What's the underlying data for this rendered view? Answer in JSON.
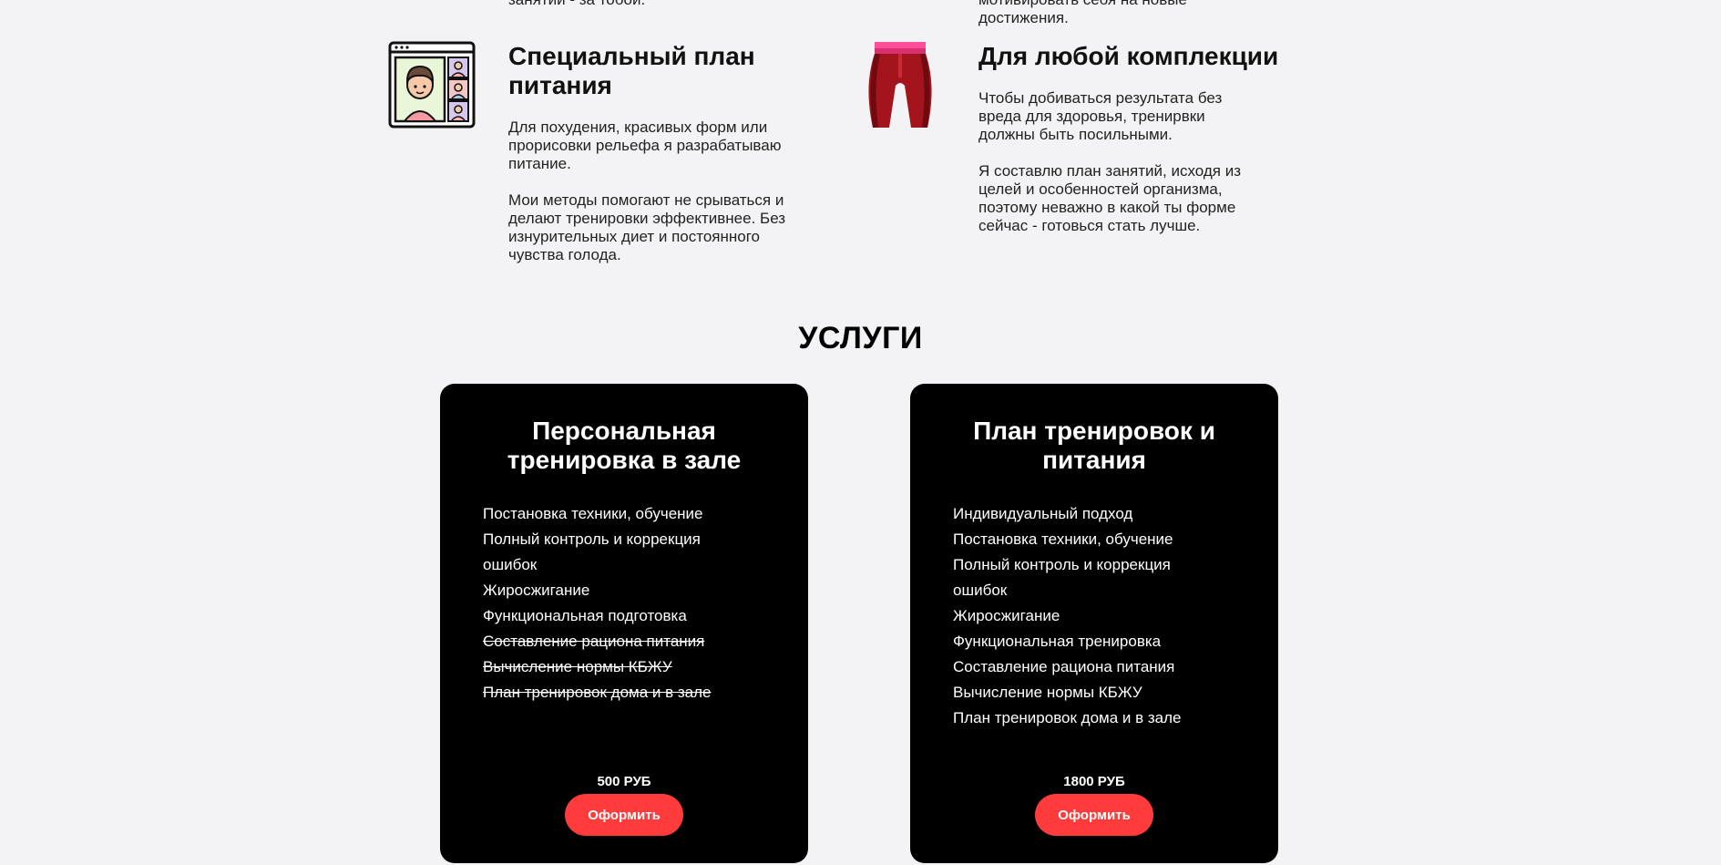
{
  "previous": {
    "left_tail": "занятий - за тобой.",
    "right_tail": [
      "мотивировать себя на новые",
      "достижения."
    ]
  },
  "features": [
    {
      "icon": "video-call-icon",
      "title": [
        "Специальный план",
        "питания"
      ],
      "paragraphs": [
        [
          "Для похудения, красивых форм или",
          "прорисовки рельефа я разрабатываю",
          "питание."
        ],
        [
          "Мои методы помогают не срываться и",
          "делают тренировки эффективнее. Без",
          "изнурительных диет и постоянного",
          "чувства голода."
        ]
      ]
    },
    {
      "icon": "leggings-icon",
      "title": [
        "Для любой комплекции"
      ],
      "paragraphs": [
        [
          "Чтобы добиваться результата без",
          "вреда для здоровья, тренирвки",
          "должны быть посильными."
        ],
        [
          "Я составлю план занятий, исходя из",
          "целей и особенностей организма,",
          "поэтому неважно в какой ты форме",
          "сейчас - готовься стать лучше."
        ]
      ]
    }
  ],
  "services": {
    "title": "УСЛУГИ",
    "cards": [
      {
        "title": [
          "Персональная",
          "тренировка в зале"
        ],
        "items": [
          {
            "text": "Постановка техники, обучение",
            "struck": false
          },
          {
            "text": "Полный контроль и коррекция",
            "struck": false
          },
          {
            "text": "ошибок",
            "struck": false
          },
          {
            "text": "Жиросжигание",
            "struck": false
          },
          {
            "text": "Функциональная подготовка",
            "struck": false
          },
          {
            "text": "Составление рациона питания",
            "struck": true
          },
          {
            "text": "Вычисление нормы КБЖУ",
            "struck": true
          },
          {
            "text": "План тренировок дома и в зале",
            "struck": true
          }
        ],
        "price": "500 РУБ",
        "button": "Оформить"
      },
      {
        "title": [
          "План тренировок и",
          "питания"
        ],
        "items": [
          {
            "text": "Индивидуальный подход",
            "struck": false
          },
          {
            "text": "Постановка техники, обучение",
            "struck": false
          },
          {
            "text": "Полный контроль и коррекция",
            "struck": false
          },
          {
            "text": "ошибок",
            "struck": false
          },
          {
            "text": "Жиросжигание",
            "struck": false
          },
          {
            "text": "Функциональная тренировка",
            "struck": false
          },
          {
            "text": "Составление рациона питания",
            "struck": false
          },
          {
            "text": "Вычисление нормы КБЖУ",
            "struck": false
          },
          {
            "text": "План тренировок дома и в зале",
            "struck": false
          }
        ],
        "price": "1800 РУБ",
        "button": "Оформить"
      }
    ]
  },
  "colors": {
    "background": "#f3f3f5",
    "card": "#000000",
    "accent": "#ff3b3b"
  }
}
